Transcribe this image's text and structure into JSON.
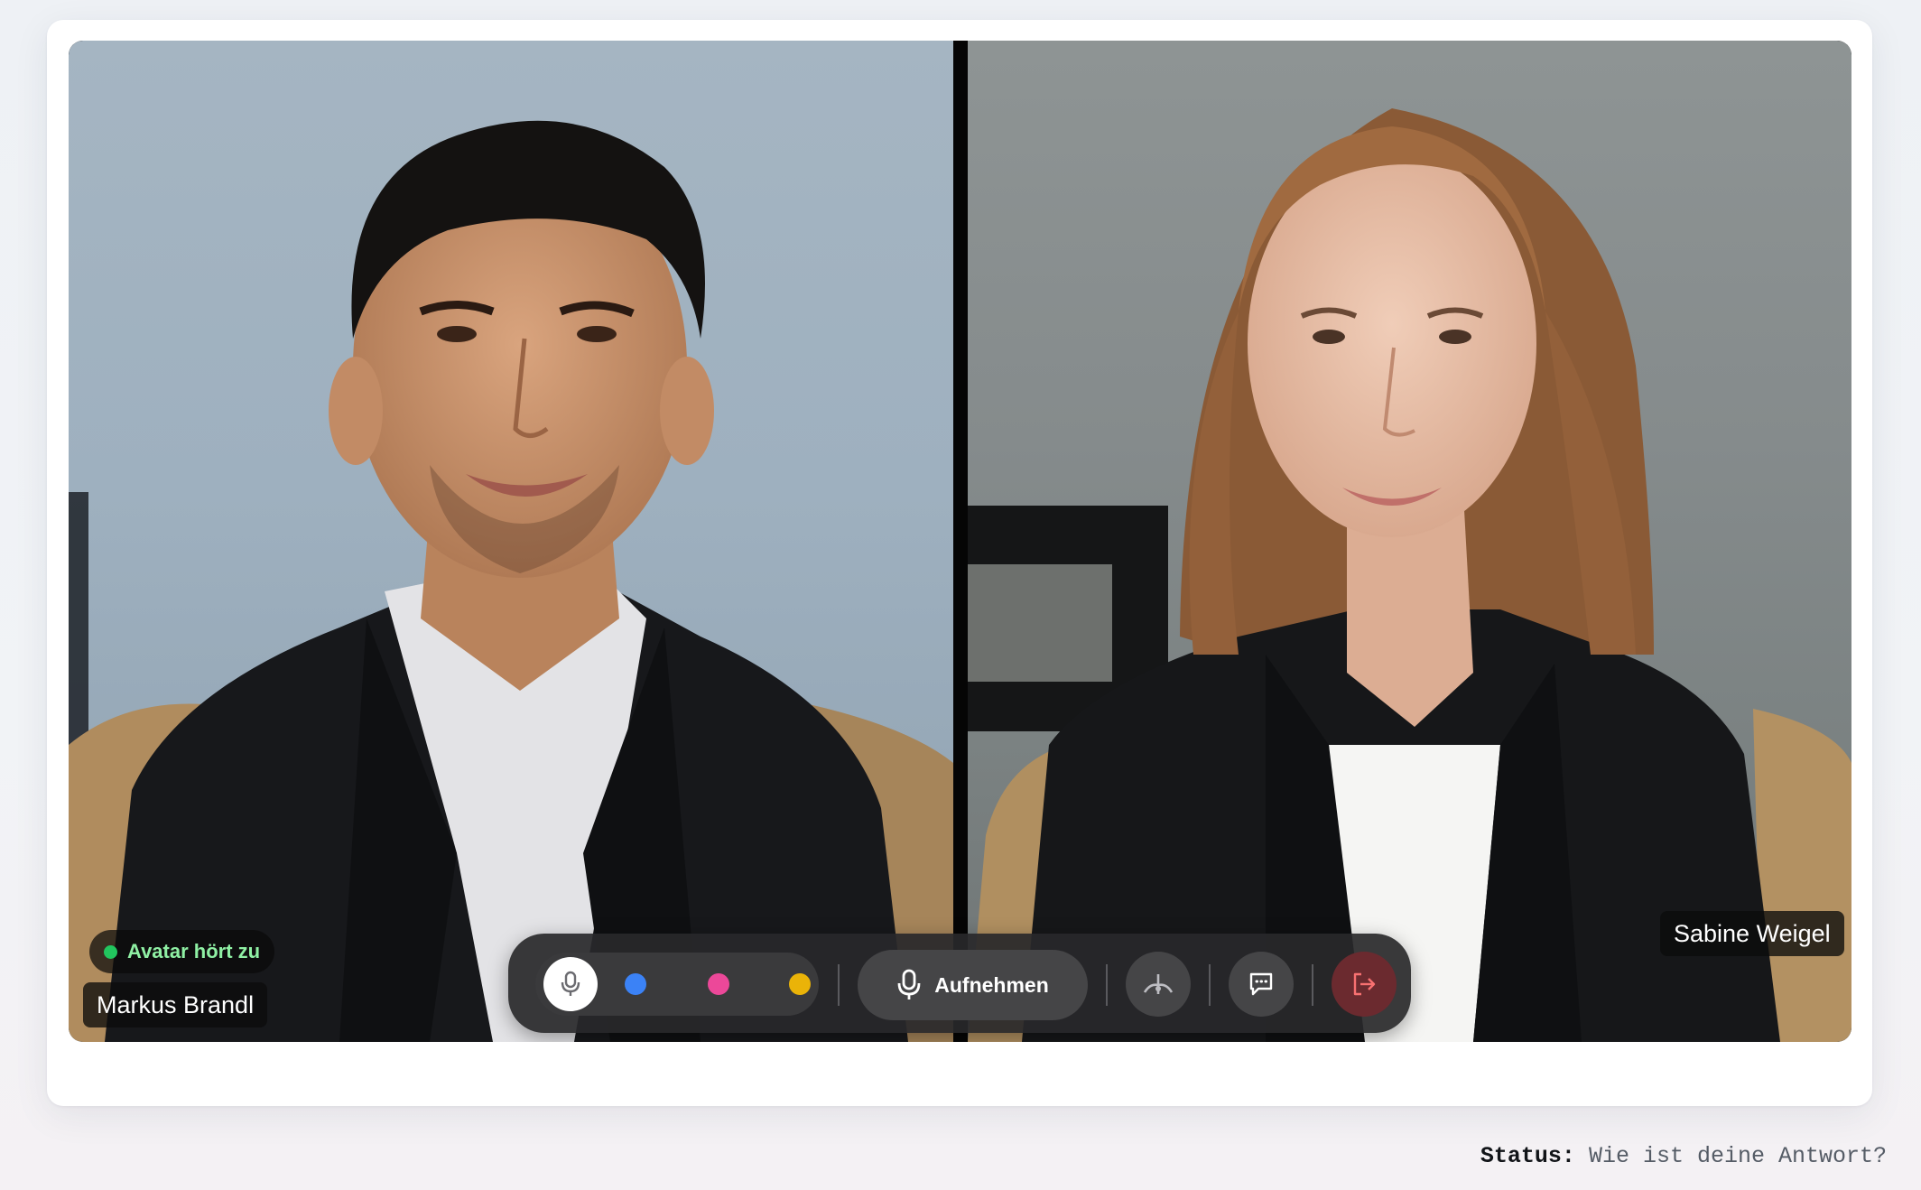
{
  "call": {
    "left_participant": {
      "name": "Markus Brandl",
      "status": "Avatar hört zu",
      "status_color": "#22c55e"
    },
    "right_participant": {
      "name": "Sabine Weigel"
    }
  },
  "toolbar": {
    "swatches": [
      {
        "name": "blue",
        "color": "#3b82f6"
      },
      {
        "name": "pink",
        "color": "#ec4899"
      },
      {
        "name": "yellow",
        "color": "#eab308"
      }
    ],
    "record_label": "Aufnehmen",
    "icons": {
      "mic": "microphone-icon",
      "record": "microphone-icon",
      "interrupt": "antenna-icon",
      "chat": "chat-icon",
      "leave": "leave-icon"
    },
    "leave_color": "#ef4444"
  },
  "footer": {
    "status_label": "Status:",
    "status_value": "Wie ist deine Antwort?"
  }
}
